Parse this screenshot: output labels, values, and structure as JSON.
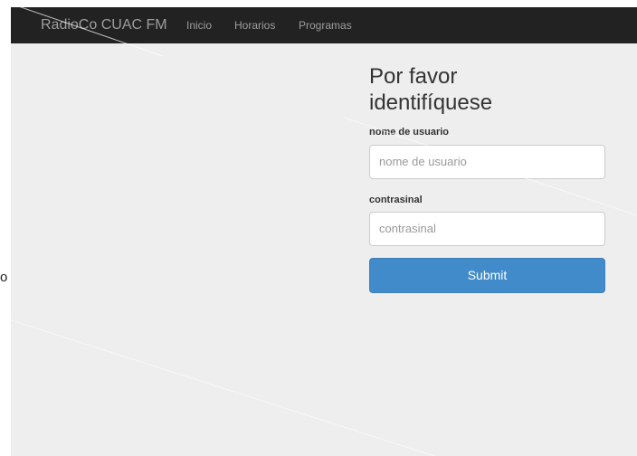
{
  "navbar": {
    "brand": "RadioCo CUAC FM",
    "links": [
      "Inicio",
      "Horarios",
      "Programas"
    ]
  },
  "login": {
    "title_line1": "Por favor",
    "title_line2": "identifíquese",
    "username_label": "nome de usuario",
    "username_placeholder": "nome de usuario",
    "password_label": "contrasinal",
    "password_placeholder": "contrasinal",
    "submit_label": "Submit"
  },
  "edge_fragment": "o",
  "colors": {
    "navbar_bg": "#222222",
    "nav_text": "#9d9d9d",
    "page_bg": "#eeeeee",
    "button_bg": "#428bca"
  }
}
